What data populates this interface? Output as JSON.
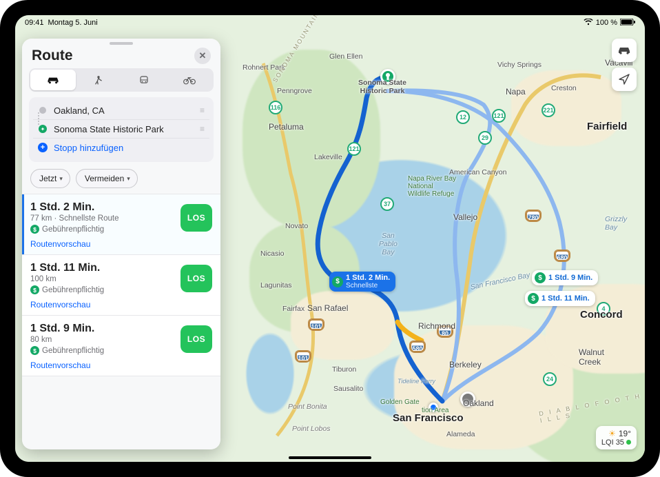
{
  "status": {
    "time": "09:41",
    "date": "Montag 5. Juni",
    "battery": "100 %"
  },
  "panel": {
    "title": "Route",
    "modes": [
      "car",
      "walk",
      "transit",
      "bike"
    ],
    "origin": "Oakland, CA",
    "destination": "Sonoma State Historic Park",
    "add_stop": "Stopp hinzufügen",
    "opt_now": "Jetzt",
    "opt_avoid": "Vermeiden",
    "go_label": "LOS",
    "preview_label": "Routenvorschau",
    "toll_label": "Gebührenpflichtig"
  },
  "routes": [
    {
      "time": "1 Std. 2 Min.",
      "dist": "77 km · Schnellste Route"
    },
    {
      "time": "1 Std. 11 Min.",
      "dist": "100 km"
    },
    {
      "time": "1 Std. 9 Min.",
      "dist": "80 km"
    }
  ],
  "map_badges": {
    "primary": {
      "line1": "1 Std. 2 Min.",
      "line2": "Schnellste"
    },
    "alt1": "1 Std. 9 Min.",
    "alt2": "1 Std. 11 Min."
  },
  "cities": {
    "sf": "San Francisco",
    "oakland": "Oakland",
    "berkeley": "Berkeley",
    "richmond": "Richmond",
    "san_rafael": "San Rafael",
    "novato": "Novato",
    "petaluma": "Petaluma",
    "napa": "Napa",
    "sonoma_park": "Sonoma State\nHistoric Park",
    "vallejo": "Vallejo",
    "fairfield": "Fairfield",
    "concord": "Concord",
    "walnut": "Walnut\nCreek",
    "amcanyon": "American Canyon",
    "rohnert": "Rohnert Park",
    "penngrove": "Penngrove",
    "sausalito": "Sausalito",
    "tiburon": "Tiburon",
    "fairfax": "Fairfax",
    "lagunitas": "Lagunitas",
    "nicasio": "Nicasio",
    "pt_bonita": "Point Bonita",
    "pt_lobos": "Point Lobos",
    "alameda": "Alameda",
    "vichy": "Vichy Springs",
    "glen_ellen": "Glen Ellen",
    "creston": "Creston",
    "vacavil": "Vacavill",
    "grizzly": "Grizzly\nBay",
    "spbay": "San\nPablo\nBay",
    "lakeville": "Lakeville",
    "wildlife": "Napa River Bay\nNational\nWildlife Refuge",
    "sonoma_mtn": "SONOMA MOUNTAINS",
    "sfbay": "San Francisco Bay",
    "goldengate": "Golden Gate",
    "tidelineferry": "Tideline Ferry",
    "recreation": "tion Area",
    "dhills": "D I A B L O   F O O T H I L L S"
  },
  "shields": {
    "i80": "80",
    "i580": "580",
    "i680": "680",
    "i780": "780",
    "us101": "101",
    "ca37": "37",
    "ca12": "12",
    "ca121": "121",
    "ca29": "29",
    "ca116": "116",
    "ca221": "221",
    "ca24": "24",
    "ca4": "4"
  },
  "weather": {
    "temp": "19°",
    "lqi": "LQI 35"
  }
}
